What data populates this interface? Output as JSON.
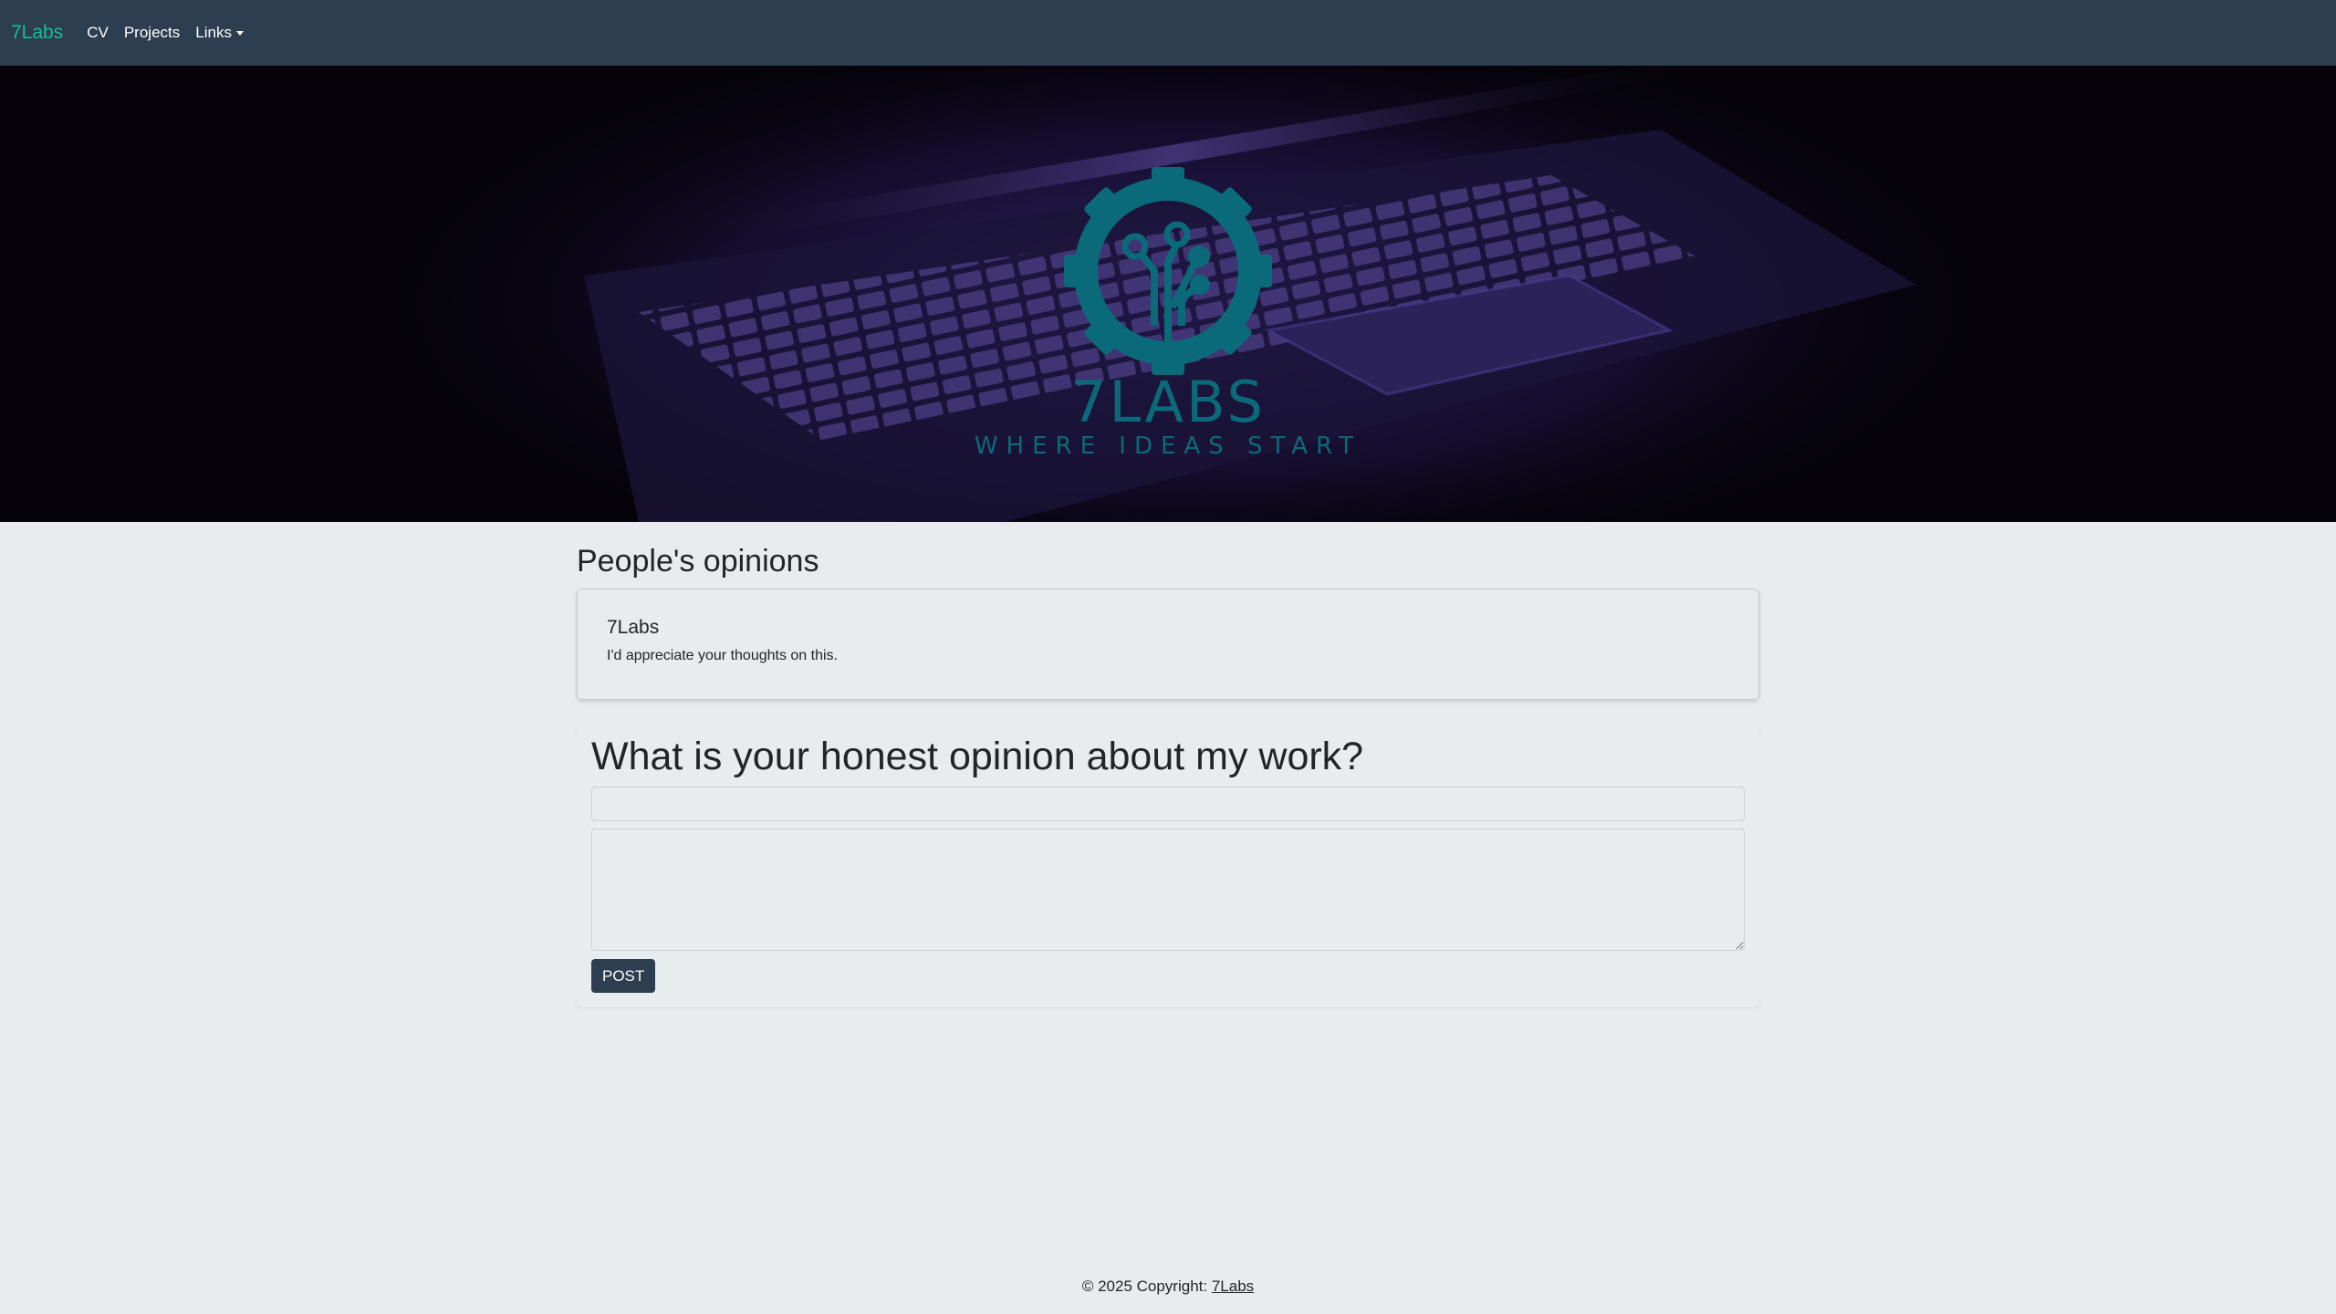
{
  "navbar": {
    "brand": "7Labs",
    "items": [
      {
        "label": "CV"
      },
      {
        "label": "Projects"
      },
      {
        "label": "Links"
      }
    ]
  },
  "hero": {
    "logo_title": "7LABS",
    "logo_tagline": "WHERE IDEAS START",
    "logo_color": "#0b6a7a"
  },
  "opinions": {
    "title": "People's opinions",
    "items": [
      {
        "author": "7Labs",
        "text": "I'd appreciate your thoughts on this."
      }
    ]
  },
  "form": {
    "title": "What is your honest opinion about my work?",
    "name_value": "",
    "message_value": "",
    "post_label": "POST"
  },
  "footer": {
    "text": "© 2025 Copyright: ",
    "link": "7Labs"
  },
  "colors": {
    "navbar_bg": "#2c3e50",
    "brand": "#1abc9c",
    "page_bg": "#e8ecef",
    "button_bg": "#2c3e50"
  }
}
